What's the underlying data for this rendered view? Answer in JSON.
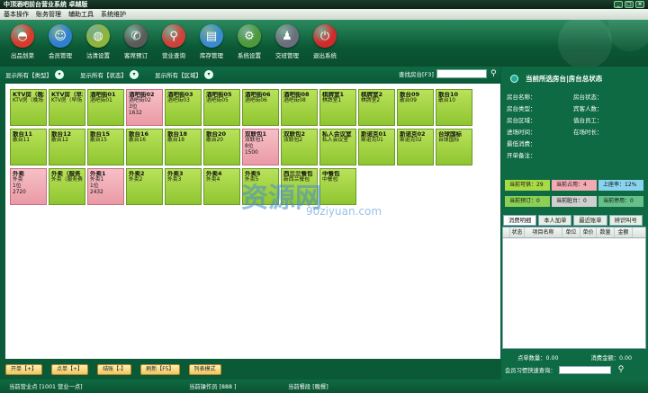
{
  "window": {
    "title": "中顶酒吧前台营业系统 卓越版"
  },
  "menu": [
    "基本操作",
    "账务管理",
    "辅助工具",
    "系统维护"
  ],
  "toolbar": [
    {
      "label": "出品划菜",
      "icon": "dish-cover-icon",
      "color": "#d93a2b"
    },
    {
      "label": "会员管理",
      "icon": "member-icon",
      "color": "#2f7fd1"
    },
    {
      "label": "沽清设置",
      "icon": "dish-icon",
      "color": "#8db53a"
    },
    {
      "label": "客席预订",
      "icon": "phone-icon",
      "color": "#5b5b5b"
    },
    {
      "label": "营业查询",
      "icon": "search-icon",
      "color": "#d2403a"
    },
    {
      "label": "库存管理",
      "icon": "inventory-icon",
      "color": "#3a8bd0"
    },
    {
      "label": "系统设置",
      "icon": "gear-icon",
      "color": "#4d9a3a"
    },
    {
      "label": "交班管理",
      "icon": "people-icon",
      "color": "#6d6d7d"
    },
    {
      "label": "退出系统",
      "icon": "power-icon",
      "color": "#d22a2a"
    }
  ],
  "filters": [
    "显示所有【类型】",
    "显示所有【状态】",
    "显示所有【区域】"
  ],
  "search": {
    "label": "查找房台[F3]",
    "value": ""
  },
  "tables": [
    {
      "name": "KTV房（晚场",
      "area": "KTV房（晚场",
      "state": "free"
    },
    {
      "name": "KTV房（早场",
      "area": "KTV房（早场",
      "state": "free"
    },
    {
      "name": "酒吧街01",
      "area": "酒吧街01",
      "state": "free"
    },
    {
      "name": "酒吧街02",
      "area": "酒吧街02",
      "state": "occ",
      "extra1": "3位",
      "extra2": "1632"
    },
    {
      "name": "酒吧街03",
      "area": "酒吧街03",
      "state": "free"
    },
    {
      "name": "酒吧街05",
      "area": "酒吧街05",
      "state": "free"
    },
    {
      "name": "酒吧街06",
      "area": "酒吧街06",
      "state": "free"
    },
    {
      "name": "酒吧街08",
      "area": "酒吧街08",
      "state": "free"
    },
    {
      "name": "棋牌室1",
      "area": "棋牌室1",
      "state": "free"
    },
    {
      "name": "棋牌室2",
      "area": "棋牌室2",
      "state": "free"
    },
    {
      "name": "散台09",
      "area": "散台09",
      "state": "free"
    },
    {
      "name": "散台10",
      "area": "散台10",
      "state": "free"
    },
    {
      "name": "散台11",
      "area": "散台11",
      "state": "free"
    },
    {
      "name": "散台12",
      "area": "散台12",
      "state": "free"
    },
    {
      "name": "散台15",
      "area": "散台15",
      "state": "free"
    },
    {
      "name": "散台16",
      "area": "散台16",
      "state": "free"
    },
    {
      "name": "散台18",
      "area": "散台18",
      "state": "free"
    },
    {
      "name": "散台20",
      "area": "散台20",
      "state": "free"
    },
    {
      "name": "双联包1",
      "area": "双联包1",
      "state": "occ",
      "extra1": "8位",
      "extra2": "1500"
    },
    {
      "name": "双联包2",
      "area": "双联包2",
      "state": "free"
    },
    {
      "name": "私人会议室",
      "area": "私人会议室",
      "state": "free"
    },
    {
      "name": "斯诺克01",
      "area": "斯诺克01",
      "state": "free"
    },
    {
      "name": "斯诺克02",
      "area": "斯诺克02",
      "state": "free"
    },
    {
      "name": "台球国标",
      "area": "台球国标",
      "state": "free"
    },
    {
      "name": "外卖",
      "area": "外卖",
      "state": "occ",
      "extra1": "1位",
      "extra2": "2720"
    },
    {
      "name": "外卖（服务",
      "area": "外卖（服务费",
      "state": "free"
    },
    {
      "name": "外卖1",
      "area": "外卖1",
      "state": "occ",
      "extra1": "1位",
      "extra2": "2432"
    },
    {
      "name": "外卖2",
      "area": "外卖2",
      "state": "free"
    },
    {
      "name": "外卖3",
      "area": "外卖3",
      "state": "free"
    },
    {
      "name": "外卖4",
      "area": "外卖4",
      "state": "free"
    },
    {
      "name": "外卖5",
      "area": "外卖5",
      "state": "free"
    },
    {
      "name": "西兰兰餐包",
      "area": "新西兰餐包",
      "state": "free"
    },
    {
      "name": "中餐包",
      "area": "中餐包",
      "state": "free"
    }
  ],
  "bottom_buttons": [
    "开单【+】",
    "点单【+】",
    "结账【-】",
    "刷新【F5】",
    "列表模式"
  ],
  "status": {
    "shop": "当前营业点 [1001 营业一点]",
    "operator": "当前操作员 [888 ]",
    "shift": "当前餐段 [晚餐]"
  },
  "right_panel": {
    "title": "当前所选房台|房台总状态",
    "left_fields": [
      "房台名称：",
      "房台类型：",
      "房台区域：",
      "进场时间：",
      "最低消费：",
      "开单备注："
    ],
    "right_fields": [
      "房台状态：",
      "宾客人数：",
      "值台员工：",
      "在场时长："
    ],
    "legend": [
      {
        "label": "当前可供：29",
        "color": "#a9d946"
      },
      {
        "label": "当前占用：4",
        "color": "#f2aab4"
      },
      {
        "label": "上座率：12%",
        "color": "#8ad3ee"
      },
      {
        "label": "当前预订：0",
        "color": "#8ccf55"
      },
      {
        "label": "当前脏台：0",
        "color": "#cfcfcf"
      },
      {
        "label": "当前停用：0",
        "color": "#66c08a"
      }
    ],
    "log_tabs": [
      "消费明细",
      "本人加单",
      "最近账单",
      "辨识叫号"
    ],
    "log_headers": [
      "状态",
      "项目名称",
      "单位",
      "单价",
      "数量",
      "金额"
    ],
    "total_qty": "点单数量：0.00",
    "total_amount": "消费金额：0.00",
    "member_search": "会员习惯快速查询："
  },
  "watermark": {
    "text": "资源网",
    "url": "90ziyuan.com"
  }
}
